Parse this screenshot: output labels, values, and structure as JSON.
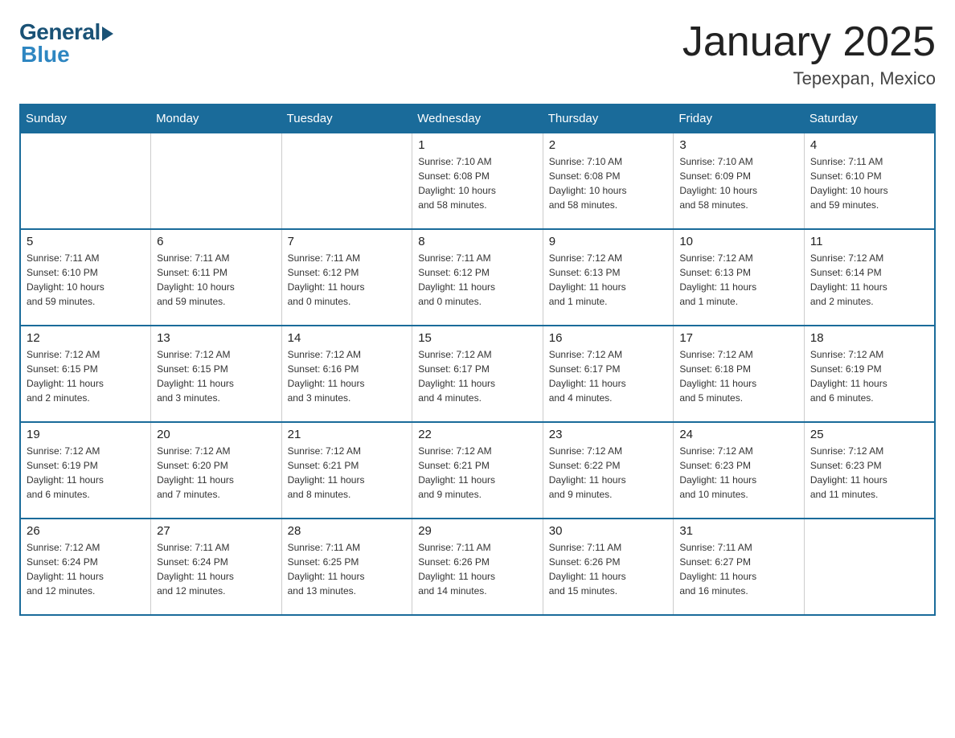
{
  "header": {
    "logo_general": "General",
    "logo_blue": "Blue",
    "title": "January 2025",
    "subtitle": "Tepexpan, Mexico"
  },
  "weekdays": [
    "Sunday",
    "Monday",
    "Tuesday",
    "Wednesday",
    "Thursday",
    "Friday",
    "Saturday"
  ],
  "weeks": [
    [
      {
        "day": "",
        "info": ""
      },
      {
        "day": "",
        "info": ""
      },
      {
        "day": "",
        "info": ""
      },
      {
        "day": "1",
        "info": "Sunrise: 7:10 AM\nSunset: 6:08 PM\nDaylight: 10 hours\nand 58 minutes."
      },
      {
        "day": "2",
        "info": "Sunrise: 7:10 AM\nSunset: 6:08 PM\nDaylight: 10 hours\nand 58 minutes."
      },
      {
        "day": "3",
        "info": "Sunrise: 7:10 AM\nSunset: 6:09 PM\nDaylight: 10 hours\nand 58 minutes."
      },
      {
        "day": "4",
        "info": "Sunrise: 7:11 AM\nSunset: 6:10 PM\nDaylight: 10 hours\nand 59 minutes."
      }
    ],
    [
      {
        "day": "5",
        "info": "Sunrise: 7:11 AM\nSunset: 6:10 PM\nDaylight: 10 hours\nand 59 minutes."
      },
      {
        "day": "6",
        "info": "Sunrise: 7:11 AM\nSunset: 6:11 PM\nDaylight: 10 hours\nand 59 minutes."
      },
      {
        "day": "7",
        "info": "Sunrise: 7:11 AM\nSunset: 6:12 PM\nDaylight: 11 hours\nand 0 minutes."
      },
      {
        "day": "8",
        "info": "Sunrise: 7:11 AM\nSunset: 6:12 PM\nDaylight: 11 hours\nand 0 minutes."
      },
      {
        "day": "9",
        "info": "Sunrise: 7:12 AM\nSunset: 6:13 PM\nDaylight: 11 hours\nand 1 minute."
      },
      {
        "day": "10",
        "info": "Sunrise: 7:12 AM\nSunset: 6:13 PM\nDaylight: 11 hours\nand 1 minute."
      },
      {
        "day": "11",
        "info": "Sunrise: 7:12 AM\nSunset: 6:14 PM\nDaylight: 11 hours\nand 2 minutes."
      }
    ],
    [
      {
        "day": "12",
        "info": "Sunrise: 7:12 AM\nSunset: 6:15 PM\nDaylight: 11 hours\nand 2 minutes."
      },
      {
        "day": "13",
        "info": "Sunrise: 7:12 AM\nSunset: 6:15 PM\nDaylight: 11 hours\nand 3 minutes."
      },
      {
        "day": "14",
        "info": "Sunrise: 7:12 AM\nSunset: 6:16 PM\nDaylight: 11 hours\nand 3 minutes."
      },
      {
        "day": "15",
        "info": "Sunrise: 7:12 AM\nSunset: 6:17 PM\nDaylight: 11 hours\nand 4 minutes."
      },
      {
        "day": "16",
        "info": "Sunrise: 7:12 AM\nSunset: 6:17 PM\nDaylight: 11 hours\nand 4 minutes."
      },
      {
        "day": "17",
        "info": "Sunrise: 7:12 AM\nSunset: 6:18 PM\nDaylight: 11 hours\nand 5 minutes."
      },
      {
        "day": "18",
        "info": "Sunrise: 7:12 AM\nSunset: 6:19 PM\nDaylight: 11 hours\nand 6 minutes."
      }
    ],
    [
      {
        "day": "19",
        "info": "Sunrise: 7:12 AM\nSunset: 6:19 PM\nDaylight: 11 hours\nand 6 minutes."
      },
      {
        "day": "20",
        "info": "Sunrise: 7:12 AM\nSunset: 6:20 PM\nDaylight: 11 hours\nand 7 minutes."
      },
      {
        "day": "21",
        "info": "Sunrise: 7:12 AM\nSunset: 6:21 PM\nDaylight: 11 hours\nand 8 minutes."
      },
      {
        "day": "22",
        "info": "Sunrise: 7:12 AM\nSunset: 6:21 PM\nDaylight: 11 hours\nand 9 minutes."
      },
      {
        "day": "23",
        "info": "Sunrise: 7:12 AM\nSunset: 6:22 PM\nDaylight: 11 hours\nand 9 minutes."
      },
      {
        "day": "24",
        "info": "Sunrise: 7:12 AM\nSunset: 6:23 PM\nDaylight: 11 hours\nand 10 minutes."
      },
      {
        "day": "25",
        "info": "Sunrise: 7:12 AM\nSunset: 6:23 PM\nDaylight: 11 hours\nand 11 minutes."
      }
    ],
    [
      {
        "day": "26",
        "info": "Sunrise: 7:12 AM\nSunset: 6:24 PM\nDaylight: 11 hours\nand 12 minutes."
      },
      {
        "day": "27",
        "info": "Sunrise: 7:11 AM\nSunset: 6:24 PM\nDaylight: 11 hours\nand 12 minutes."
      },
      {
        "day": "28",
        "info": "Sunrise: 7:11 AM\nSunset: 6:25 PM\nDaylight: 11 hours\nand 13 minutes."
      },
      {
        "day": "29",
        "info": "Sunrise: 7:11 AM\nSunset: 6:26 PM\nDaylight: 11 hours\nand 14 minutes."
      },
      {
        "day": "30",
        "info": "Sunrise: 7:11 AM\nSunset: 6:26 PM\nDaylight: 11 hours\nand 15 minutes."
      },
      {
        "day": "31",
        "info": "Sunrise: 7:11 AM\nSunset: 6:27 PM\nDaylight: 11 hours\nand 16 minutes."
      },
      {
        "day": "",
        "info": ""
      }
    ]
  ]
}
